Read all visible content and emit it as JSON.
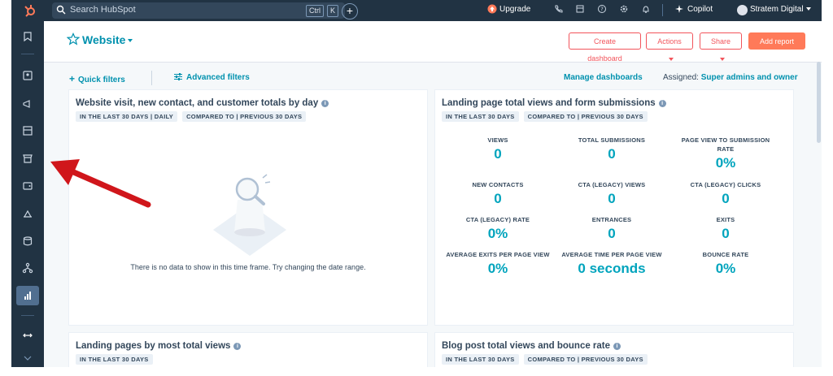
{
  "topbar": {
    "search_placeholder": "Search HubSpot",
    "kbd_ctrl": "Ctrl",
    "kbd_k": "K",
    "upgrade": "Upgrade",
    "copilot": "Copilot",
    "account": "Stratem Digital"
  },
  "header": {
    "title": "Website",
    "create_dashboard": "Create dashboard",
    "actions": "Actions",
    "share": "Share",
    "add_report": "Add report"
  },
  "filters": {
    "quick": "Quick filters",
    "advanced": "Advanced filters",
    "manage": "Manage dashboards",
    "assigned_label": "Assigned:",
    "assigned_value": "Super admins and owner"
  },
  "cards": {
    "c1": {
      "title": "Website visit, new contact, and customer totals by day",
      "tag1": "IN THE LAST 30 DAYS | DAILY",
      "tag2": "COMPARED TO | PREVIOUS 30 DAYS",
      "nodata": "There is no data to show in this time frame. Try changing the date range."
    },
    "c2": {
      "title": "Landing page total views and form submissions",
      "tag1": "IN THE LAST 30 DAYS",
      "tag2": "COMPARED TO | PREVIOUS 30 DAYS",
      "metrics": [
        {
          "label": "VIEWS",
          "value": "0"
        },
        {
          "label": "TOTAL SUBMISSIONS",
          "value": "0"
        },
        {
          "label": "PAGE VIEW TO SUBMISSION RATE",
          "value": "0%"
        },
        {
          "label": "NEW CONTACTS",
          "value": "0"
        },
        {
          "label": "CTA (LEGACY) VIEWS",
          "value": "0"
        },
        {
          "label": "CTA (LEGACY) CLICKS",
          "value": "0"
        },
        {
          "label": "CTA (LEGACY) RATE",
          "value": "0%"
        },
        {
          "label": "ENTRANCES",
          "value": "0"
        },
        {
          "label": "EXITS",
          "value": "0"
        },
        {
          "label": "AVERAGE EXITS PER PAGE VIEW",
          "value": "0%"
        },
        {
          "label": "AVERAGE TIME PER PAGE VIEW",
          "value": "0 seconds"
        },
        {
          "label": "BOUNCE RATE",
          "value": "0%"
        }
      ]
    },
    "c3": {
      "title": "Landing pages by most total views",
      "tag1": "IN THE LAST 30 DAYS"
    },
    "c4": {
      "title": "Blog post total views and bounce rate",
      "tag1": "IN THE LAST 30 DAYS",
      "tag2": "COMPARED TO | PREVIOUS 30 DAYS"
    }
  },
  "colors": {
    "nav": "#213343",
    "accent": "#00a4bd",
    "link": "#0091ae",
    "primary_button": "#ff7a59",
    "annotation_arrow": "#d0161b"
  }
}
